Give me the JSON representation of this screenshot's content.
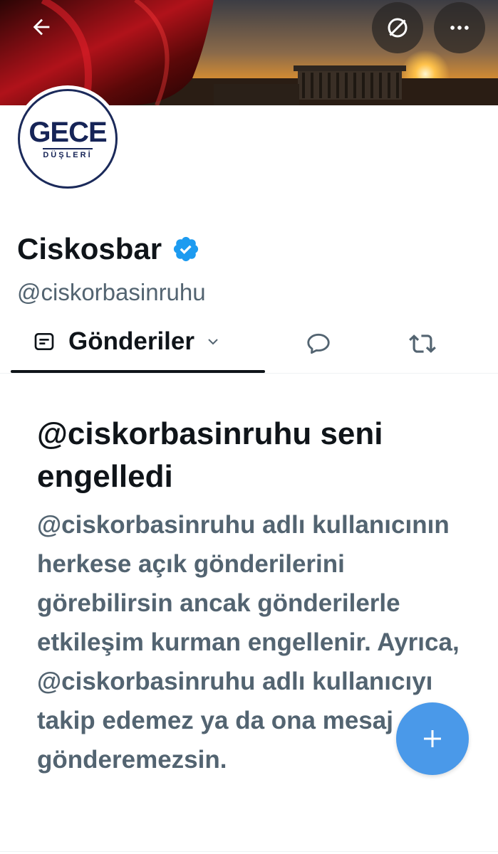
{
  "header": {
    "back_icon": "arrow-left-icon",
    "block_icon": "blocked-circle-icon",
    "more_icon": "more-horizontal-icon"
  },
  "profile": {
    "avatar_logo_main": "GECE",
    "avatar_logo_sub": "DÜŞLERİ",
    "display_name": "Ciskosbar",
    "verified_icon": "verified-badge-icon",
    "verified_color": "#1d9bf0",
    "handle": "@ciskorbasinruhu"
  },
  "tabs": {
    "active_label": "Gönderiler",
    "active_icon": "posts-icon",
    "dropdown_icon": "chevron-down-icon",
    "replies_icon": "reply-bubble-icon",
    "reposts_icon": "repost-icon"
  },
  "blocked": {
    "title": "@ciskorbasinruhu seni engelledi",
    "body": "@ciskorbasinruhu adlı kullanıcının herkese açık gönderilerini görebilirsin ancak gönderilerle etkileşim kurman engellenir. Ayrıca, @ciskorbasinruhu adlı kullanıcıyı takip edemez ya da ona mesaj gönderemezsin."
  },
  "fab": {
    "icon": "plus-icon",
    "color": "#4a99e9"
  }
}
